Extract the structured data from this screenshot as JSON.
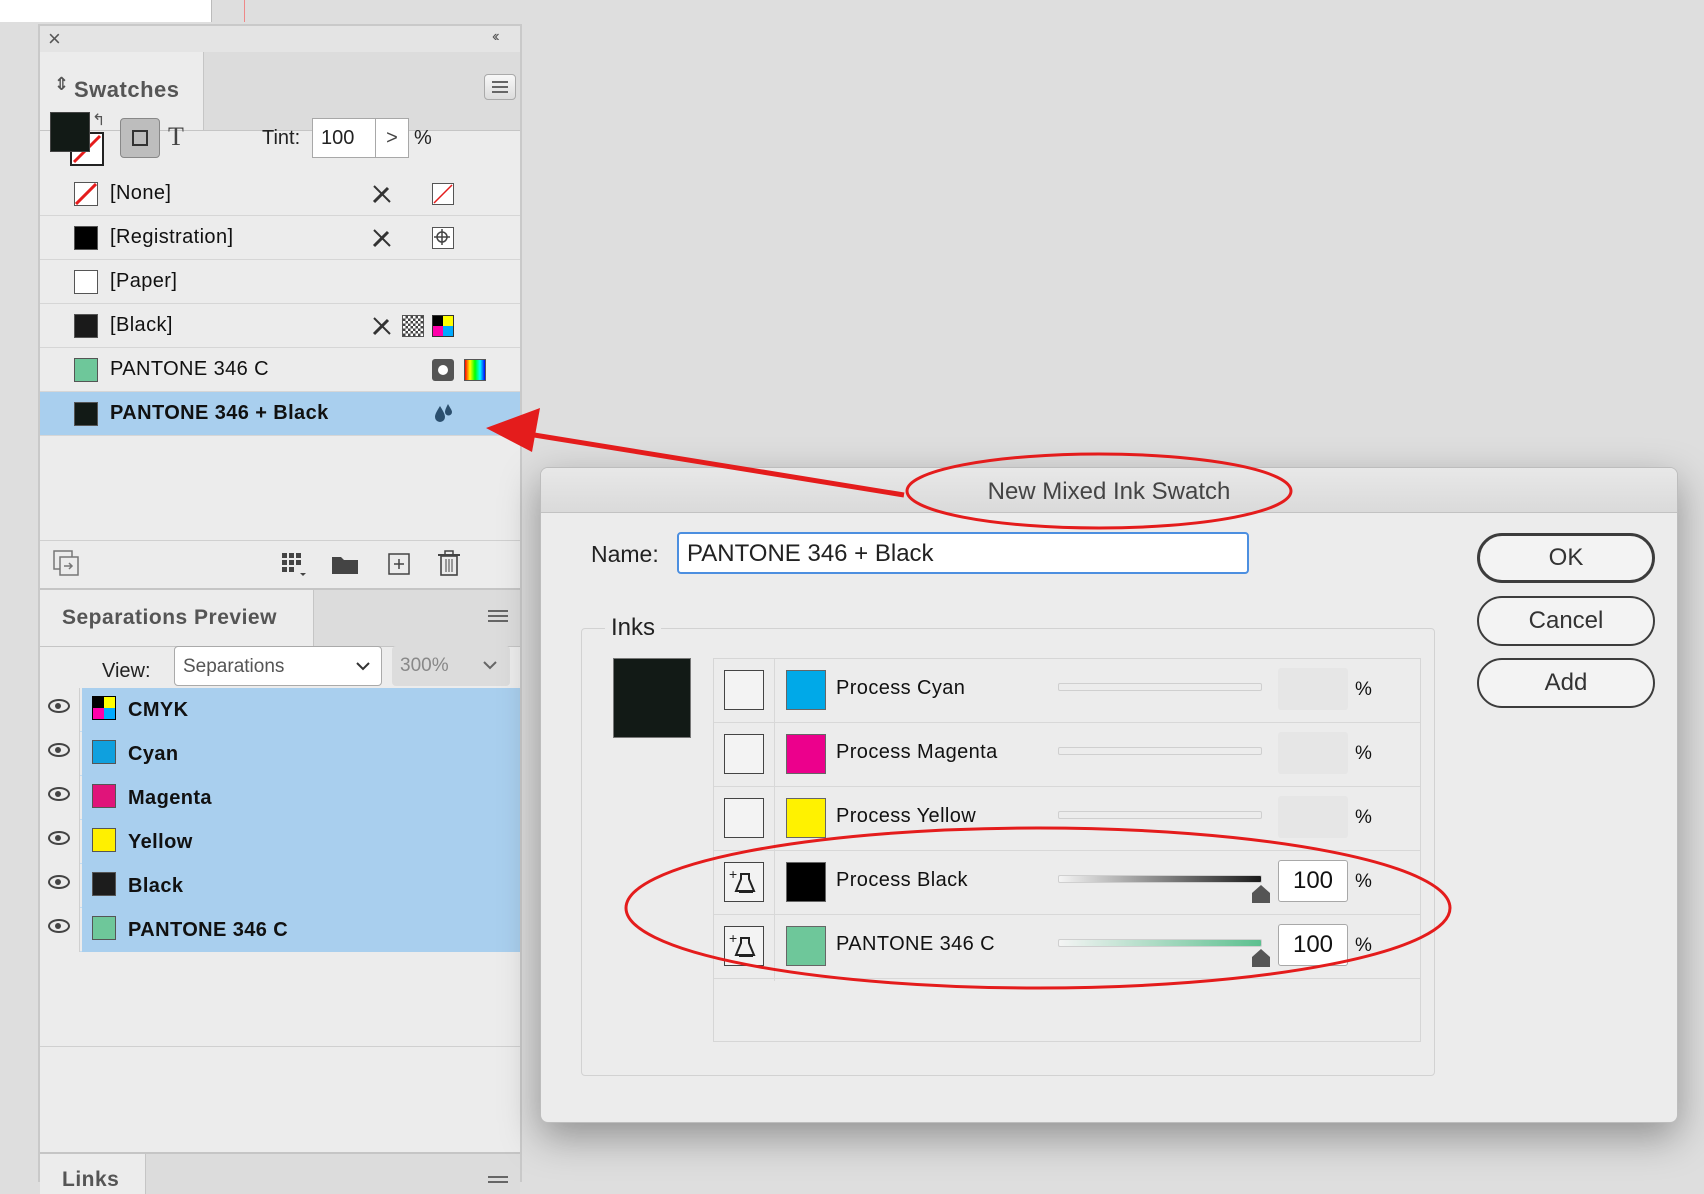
{
  "swatches_panel": {
    "close_glyph": "×",
    "collapse_glyph": "‹‹",
    "tab_title": "Swatches",
    "tint_label": "Tint:",
    "tint_value": "100",
    "tint_arrow": ">",
    "tint_unit": "%",
    "text_glyph": "T",
    "items": [
      {
        "name": "[None]",
        "color": "#ffffff",
        "selected": false
      },
      {
        "name": "[Registration]",
        "color": "#000000",
        "selected": false
      },
      {
        "name": "[Paper]",
        "color": "#ffffff",
        "selected": false
      },
      {
        "name": "[Black]",
        "color": "#1a1a1a",
        "selected": false
      },
      {
        "name": "PANTONE 346 C",
        "color": "#6ec79a",
        "selected": false
      },
      {
        "name": "PANTONE 346 + Black",
        "color": "#121a16",
        "selected": true
      }
    ]
  },
  "separations_panel": {
    "tab_title": "Separations Preview",
    "view_label": "View:",
    "view_value": "Separations",
    "zoom_value": "300%",
    "plates": [
      {
        "name": "CMYK",
        "color": "#000000"
      },
      {
        "name": "Cyan",
        "color": "#0fa0de"
      },
      {
        "name": "Magenta",
        "color": "#e0147a"
      },
      {
        "name": "Yellow",
        "color": "#fff000"
      },
      {
        "name": "Black",
        "color": "#1c1c1c"
      },
      {
        "name": "PANTONE 346 C",
        "color": "#6ec79a"
      }
    ]
  },
  "links_panel": {
    "tab_title": "Links"
  },
  "dialog": {
    "title": "New Mixed Ink Swatch",
    "name_label": "Name:",
    "name_value": "PANTONE 346 + Black",
    "inks_label": "Inks",
    "preview_color": "#121a16",
    "buttons": {
      "ok": "OK",
      "cancel": "Cancel",
      "add": "Add"
    },
    "inks": [
      {
        "name": "Process Cyan",
        "color": "#00a9e8",
        "active": false,
        "percent": "",
        "unit": "%"
      },
      {
        "name": "Process Magenta",
        "color": "#ec008c",
        "active": false,
        "percent": "",
        "unit": "%"
      },
      {
        "name": "Process Yellow",
        "color": "#fff200",
        "active": false,
        "percent": "",
        "unit": "%"
      },
      {
        "name": "Process Black",
        "color": "#000000",
        "active": true,
        "percent": "100",
        "unit": "%"
      },
      {
        "name": "PANTONE 346 C",
        "color": "#6ec79a",
        "active": true,
        "percent": "100",
        "unit": "%"
      }
    ]
  },
  "annotation": {
    "color": "#e41c1c"
  }
}
